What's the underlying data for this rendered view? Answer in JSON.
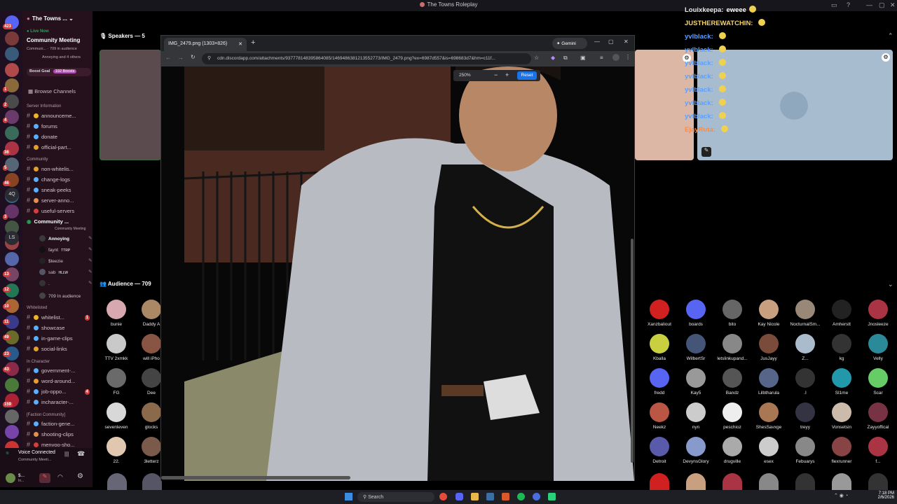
{
  "app": {
    "title": "The Towns Roleplay"
  },
  "server": {
    "name": "The Towns ...",
    "event_live": "Live Now",
    "event_name": "Community Meeting",
    "event_meta": "Communi... · 709 in audience",
    "event_people": "Annoying and 4 others",
    "boost_goal": "Boost Goal",
    "boost_count": "192 Boosts",
    "browse": "Browse Channels"
  },
  "rail_badges": [
    "423",
    "1",
    "2",
    "4",
    "36",
    "5",
    "46",
    "3",
    "13",
    "12",
    "10",
    "11",
    "49",
    "23",
    "43",
    "159",
    "NEW"
  ],
  "rail_labels": [
    "4Q",
    "LS"
  ],
  "categories": {
    "info": "Server Information",
    "community": "Community",
    "whitelisted": "Whitelisted",
    "incharacter": "In Character",
    "faction": "[Faction Community]"
  },
  "channels_info": [
    "announceme...",
    "forums",
    "donate",
    "official-part..."
  ],
  "channels_community": [
    "non-whitelis...",
    "change-logs",
    "sneak-peeks",
    "server-anno...",
    "useful-servers"
  ],
  "stage_channel": {
    "name": "Community ...",
    "sub": "Community Meeting",
    "audience": "709 In audience"
  },
  "voice_users": [
    "Annoying",
    "faynt",
    "$teezie",
    "sab",
    "."
  ],
  "voice_tags": [
    "",
    "TTRP",
    "",
    "HLLW",
    ""
  ],
  "channels_whitelisted": [
    "whitelist...",
    "showcase",
    "in-game-clips",
    "social-links"
  ],
  "whitelisted_badge": "1",
  "channels_incharacter": [
    "government-...",
    "word-around...",
    "job-oppo...",
    "incharacter-..."
  ],
  "incharacter_badge": "4",
  "channels_faction": [
    "faction-gene...",
    "shooting-clips",
    "menvoo-sho..."
  ],
  "voice_status": {
    "title": "Voice Connected",
    "sub": "Community Meeti..."
  },
  "user": {
    "name": "$...",
    "status": "In..."
  },
  "stage": {
    "speakers_label": "Speakers — 5",
    "audience_label": "Audience — 709"
  },
  "audience_left": [
    "bunie",
    "Daddy A",
    "TTV 2xmkk",
    "will iPho",
    "FG",
    "Dee",
    "sevenleven",
    "glocks",
    "22.",
    "3letterz"
  ],
  "audience_right": [
    [
      "Xanzbaliout",
      "boards",
      "bito",
      "Kay Nicole",
      "NocturnalSm...",
      "Amherstt",
      "Jnosleeze"
    ],
    [
      "Kballa",
      "WilbertSr",
      "letslinkupand...",
      "JusJayy",
      "Z...",
      "kg",
      "Velly"
    ],
    [
      "fredd",
      "Kay5",
      "Bandz",
      "Lilbtharula",
      ".I",
      "Sl1me",
      "Scar"
    ],
    [
      "Neekz",
      "nyn",
      "peschioz",
      "ShesSavxge",
      "treyy",
      "Vonsetsin",
      "Zayyoffical"
    ],
    [
      "Detroit",
      "DevynsGlory",
      "drugville",
      "esex",
      "Febuarys",
      "flexrunner",
      "f..."
    ]
  ],
  "chat": [
    {
      "user": "Louixkeepa:",
      "msg": "eweee",
      "color": "#e6e6e6"
    },
    {
      "user": "JUSTHEREWATCHIN:",
      "msg": "",
      "color": "#f4d36b"
    },
    {
      "user": "yvlblack:",
      "msg": "",
      "color": "#5aa0ff"
    },
    {
      "user": "yvlblack:",
      "msg": "",
      "color": "#5aa0ff"
    },
    {
      "user": "yvlblack:",
      "msg": "",
      "color": "#5aa0ff"
    },
    {
      "user": "yvlblack:",
      "msg": "",
      "color": "#5aa0ff"
    },
    {
      "user": "yvlblack:",
      "msg": "",
      "color": "#5aa0ff"
    },
    {
      "user": "yvlblack:",
      "msg": "",
      "color": "#5aa0ff"
    },
    {
      "user": "yvlblack:",
      "msg": "",
      "color": "#5aa0ff"
    },
    {
      "user": "EjayRuta:",
      "msg": "",
      "color": "#ff8a3d"
    }
  ],
  "browser": {
    "tab_title": "IMG_2479.png (1303×826)",
    "url": "cdn.discordapp.com/attachments/937778148395864085/1469486381213552773/IMG_2479.png?ex=6987d557&is=698683d7&hm=c11f...",
    "gemini": "Gemini",
    "zoom": "250%",
    "reset": "Reset"
  },
  "taskbar": {
    "search": "Search",
    "time": "7:18 PM",
    "date": "2/6/2026"
  },
  "colors": {
    "accent": "#5865f2",
    "live": "#23a55a",
    "boost": "#b44bb4",
    "chat_name": "#5aa0ff"
  }
}
